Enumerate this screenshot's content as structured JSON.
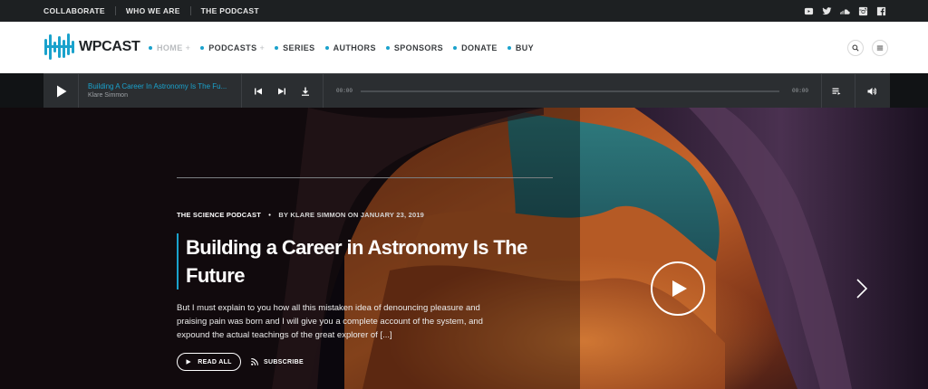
{
  "topbar": {
    "links": [
      "COLLABORATE",
      "WHO WE ARE",
      "THE PODCAST"
    ],
    "social_icons": [
      "youtube-icon",
      "twitter-icon",
      "soundcloud-icon",
      "instagram-icon",
      "facebook-icon"
    ]
  },
  "header": {
    "logo_text": "WPCAST",
    "nav": [
      {
        "label": "HOME",
        "has_plus": true,
        "plus": "+",
        "active": true
      },
      {
        "label": "PODCASTS",
        "has_plus": true,
        "plus": "+",
        "active": false
      },
      {
        "label": "SERIES",
        "active": false
      },
      {
        "label": "AUTHORS",
        "active": false
      },
      {
        "label": "SPONSORS",
        "active": false
      },
      {
        "label": "DONATE",
        "active": false
      },
      {
        "label": "BUY",
        "active": false
      }
    ],
    "icons": [
      "search-icon",
      "menu-icon"
    ]
  },
  "player": {
    "title": "Building A Career In Astronomy Is The Fu...",
    "author": "Klare Simmon",
    "time_current": "00:00",
    "time_total": "00:00",
    "progress": 0
  },
  "hero": {
    "category": "THE SCIENCE PODCAST",
    "bullet": "•",
    "byline": "BY KLARE SIMMON ON JANUARY 23, 2019",
    "title": "Building a Career in Astronomy Is The Future",
    "excerpt": "But I must explain to you how all this mistaken idea of denouncing pleasure and praising pain was born and I will give you a complete account of the system, and expound the actual teachings of the great explorer of [...]",
    "read_all": "READ ALL",
    "subscribe": "SUBSCRIBE"
  },
  "colors": {
    "accent": "#1aa2cc",
    "topbar_bg": "#1d2022",
    "player_bg": "#2b2e31"
  }
}
